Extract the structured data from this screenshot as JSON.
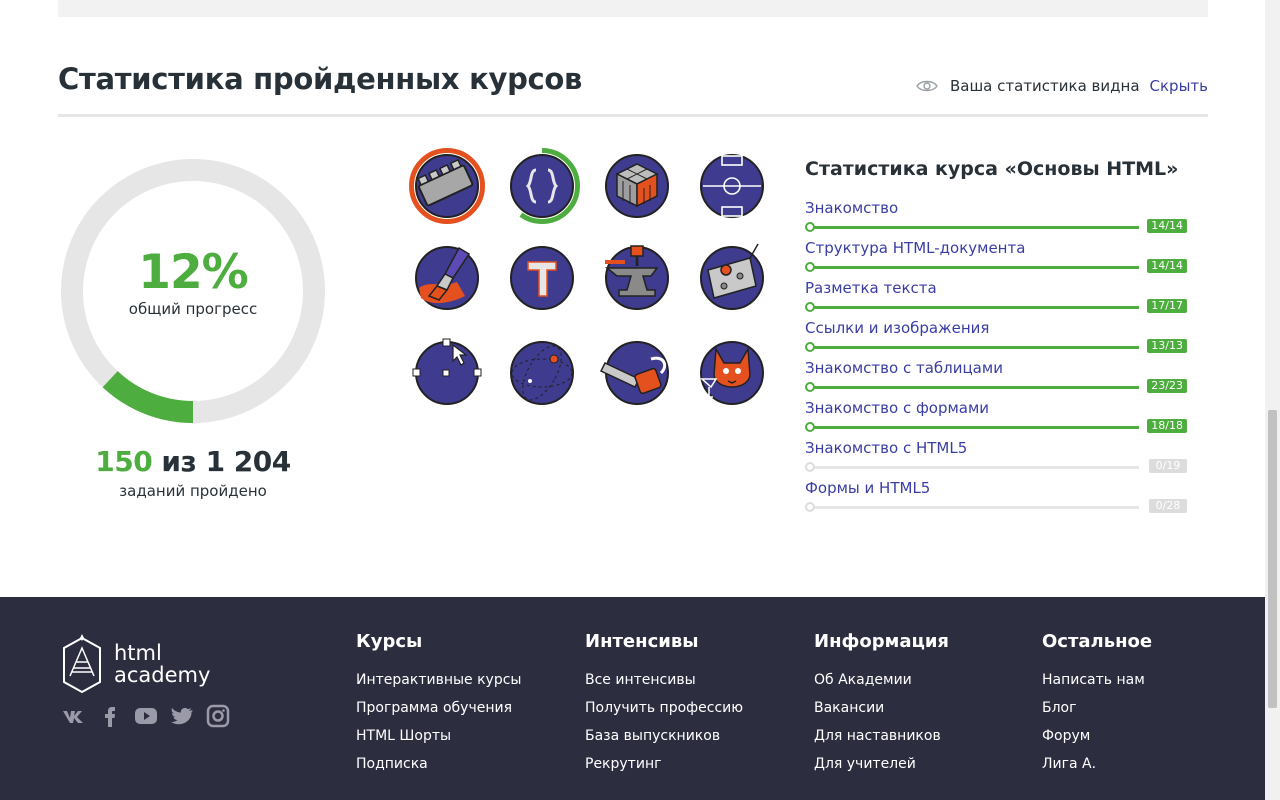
{
  "stats": {
    "title": "Статистика пройденных курсов",
    "visibility_text": "Ваша статистика видна",
    "hide_link": "Скрыть",
    "progress": {
      "percent_text": "12%",
      "percent_value": 12,
      "label": "общий прогресс",
      "done": "150",
      "sep": " из ",
      "total": "1 204",
      "tasks_label": "заданий пройдено"
    },
    "badges": [
      {
        "name": "lego-brick-badge-icon",
        "progress": 1.0
      },
      {
        "name": "curly-braces-badge-icon",
        "progress": 0.6
      },
      {
        "name": "rubiks-cube-badge-icon"
      },
      {
        "name": "football-field-badge-icon"
      },
      {
        "name": "paint-brush-badge-icon"
      },
      {
        "name": "letter-t-badge-icon"
      },
      {
        "name": "anvil-badge-icon"
      },
      {
        "name": "robot-controller-badge-icon"
      },
      {
        "name": "vector-pen-badge-icon"
      },
      {
        "name": "orbit-badge-icon"
      },
      {
        "name": "chainsaw-badge-icon"
      },
      {
        "name": "cat-badge-icon"
      }
    ]
  },
  "course": {
    "title": "Статистика курса «Основы HTML»",
    "items": [
      {
        "name": "Знакомство",
        "count": "14/14",
        "done": 14,
        "total": 14
      },
      {
        "name": "Структура HTML-документа",
        "count": "14/14",
        "done": 14,
        "total": 14
      },
      {
        "name": "Разметка текста",
        "count": "17/17",
        "done": 17,
        "total": 17
      },
      {
        "name": "Ссылки и изображения",
        "count": "13/13",
        "done": 13,
        "total": 13
      },
      {
        "name": "Знакомство с таблицами",
        "count": "23/23",
        "done": 23,
        "total": 23
      },
      {
        "name": "Знакомство с формами",
        "count": "18/18",
        "done": 18,
        "total": 18
      },
      {
        "name": "Знакомство с HTML5",
        "count": "0/19",
        "done": 0,
        "total": 19
      },
      {
        "name": "Формы и HTML5",
        "count": "0/28",
        "done": 0,
        "total": 28
      }
    ]
  },
  "colors": {
    "accent": "#4dad3f",
    "link": "#3a3ea3",
    "badge_bg": "#3f3b8f",
    "orange": "#e5501f",
    "footer_bg": "#2d2d40"
  },
  "footer": {
    "logo_line1": "html",
    "logo_line2": "academy",
    "socials": [
      "vk-icon",
      "facebook-icon",
      "youtube-icon",
      "twitter-icon",
      "instagram-icon"
    ],
    "columns": [
      {
        "title": "Курсы",
        "links": [
          "Интерактивные курсы",
          "Программа обучения",
          "HTML Шорты",
          "Подписка"
        ]
      },
      {
        "title": "Интенсивы",
        "links": [
          "Все интенсивы",
          "Получить профессию",
          "База выпускников",
          "Рекрутинг"
        ]
      },
      {
        "title": "Информация",
        "links": [
          "Об Академии",
          "Вакансии",
          "Для наставников",
          "Для учителей"
        ]
      },
      {
        "title": "Остальное",
        "links": [
          "Написать нам",
          "Блог",
          "Форум",
          "Лига А."
        ]
      }
    ]
  }
}
